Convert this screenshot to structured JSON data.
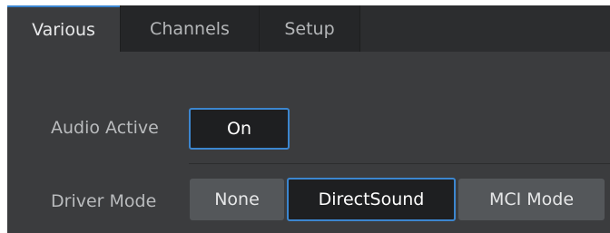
{
  "tabs": [
    {
      "label": "Various",
      "active": true
    },
    {
      "label": "Channels",
      "active": false
    },
    {
      "label": "Setup",
      "active": false
    }
  ],
  "audio_active": {
    "label": "Audio Active",
    "button_label": "On",
    "state": "on"
  },
  "driver_mode": {
    "label": "Driver Mode",
    "options": [
      "None",
      "DirectSound",
      "MCI Mode"
    ],
    "selected": "DirectSound"
  },
  "colors": {
    "accent": "#3c86cf",
    "panel_bg": "#3b3c3e",
    "tabbar_bg": "#2c2d2f",
    "button_bg": "#54575a",
    "selected_button_bg": "#1e1f21"
  }
}
